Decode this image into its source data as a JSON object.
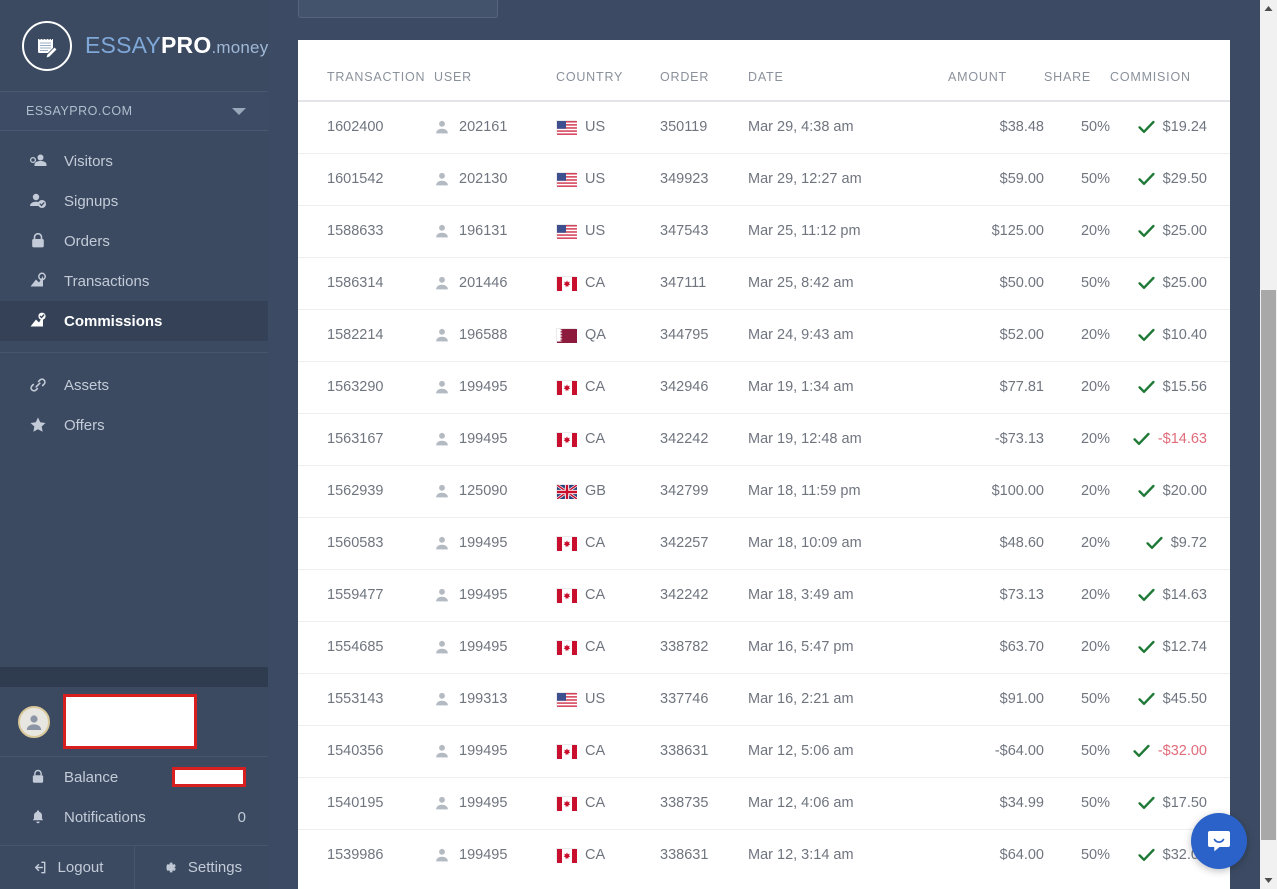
{
  "brand": {
    "logo_essay": "ESSAY",
    "logo_pro": "PRO",
    "logo_money": ".money",
    "accent_color": "#7fa8d8",
    "sidebar_color": "#3b4a61"
  },
  "sidebar": {
    "site_selector": {
      "label": "ESSAYPRO.COM",
      "icon": "chevron-down-icon"
    },
    "nav_primary": [
      {
        "label": "Visitors",
        "icon": "visitors-icon",
        "active": false
      },
      {
        "label": "Signups",
        "icon": "signups-icon",
        "active": false
      },
      {
        "label": "Orders",
        "icon": "orders-icon",
        "active": false
      },
      {
        "label": "Transactions",
        "icon": "transactions-icon",
        "active": false
      },
      {
        "label": "Commissions",
        "icon": "commissions-icon",
        "active": true
      }
    ],
    "nav_secondary": [
      {
        "label": "Assets",
        "icon": "link-icon",
        "active": false
      },
      {
        "label": "Offers",
        "icon": "star-icon",
        "active": false
      }
    ],
    "profile": {
      "username": "",
      "username_redacted": true,
      "avatar_icon": "avatar-icon"
    },
    "meta": [
      {
        "label": "Balance",
        "icon": "lock-icon",
        "value": "",
        "redacted": true
      },
      {
        "label": "Notifications",
        "icon": "bell-icon",
        "value": "0",
        "redacted": false
      }
    ],
    "bottom": [
      {
        "label": "Logout",
        "icon": "logout-icon"
      },
      {
        "label": "Settings",
        "icon": "gear-icon"
      }
    ]
  },
  "table": {
    "headers": {
      "transaction": "TRANSACTION",
      "user": "USER",
      "country": "COUNTRY",
      "order": "ORDER",
      "date": "DATE",
      "amount": "AMOUNT",
      "share": "SHARE",
      "commision": "COMMISION"
    },
    "rows": [
      {
        "transaction": "1602400",
        "user": "202161",
        "country": "US",
        "order": "350119",
        "date": "Mar 29, 4:38 am",
        "amount": "$38.48",
        "share": "50%",
        "commision": "$19.24",
        "amount_negative": false,
        "commision_negative": false,
        "approved": true
      },
      {
        "transaction": "1601542",
        "user": "202130",
        "country": "US",
        "order": "349923",
        "date": "Mar 29, 12:27 am",
        "amount": "$59.00",
        "share": "50%",
        "commision": "$29.50",
        "amount_negative": false,
        "commision_negative": false,
        "approved": true
      },
      {
        "transaction": "1588633",
        "user": "196131",
        "country": "US",
        "order": "347543",
        "date": "Mar 25, 11:12 pm",
        "amount": "$125.00",
        "share": "20%",
        "commision": "$25.00",
        "amount_negative": false,
        "commision_negative": false,
        "approved": true
      },
      {
        "transaction": "1586314",
        "user": "201446",
        "country": "CA",
        "order": "347111",
        "date": "Mar 25, 8:42 am",
        "amount": "$50.00",
        "share": "50%",
        "commision": "$25.00",
        "amount_negative": false,
        "commision_negative": false,
        "approved": true
      },
      {
        "transaction": "1582214",
        "user": "196588",
        "country": "QA",
        "order": "344795",
        "date": "Mar 24, 9:43 am",
        "amount": "$52.00",
        "share": "20%",
        "commision": "$10.40",
        "amount_negative": false,
        "commision_negative": false,
        "approved": true
      },
      {
        "transaction": "1563290",
        "user": "199495",
        "country": "CA",
        "order": "342946",
        "date": "Mar 19, 1:34 am",
        "amount": "$77.81",
        "share": "20%",
        "commision": "$15.56",
        "amount_negative": false,
        "commision_negative": false,
        "approved": true
      },
      {
        "transaction": "1563167",
        "user": "199495",
        "country": "CA",
        "order": "342242",
        "date": "Mar 19, 12:48 am",
        "amount": "-$73.13",
        "share": "20%",
        "commision": "-$14.63",
        "amount_negative": true,
        "commision_negative": true,
        "approved": true
      },
      {
        "transaction": "1562939",
        "user": "125090",
        "country": "GB",
        "order": "342799",
        "date": "Mar 18, 11:59 pm",
        "amount": "$100.00",
        "share": "20%",
        "commision": "$20.00",
        "amount_negative": false,
        "commision_negative": false,
        "approved": true
      },
      {
        "transaction": "1560583",
        "user": "199495",
        "country": "CA",
        "order": "342257",
        "date": "Mar 18, 10:09 am",
        "amount": "$48.60",
        "share": "20%",
        "commision": "$9.72",
        "amount_negative": false,
        "commision_negative": false,
        "approved": true
      },
      {
        "transaction": "1559477",
        "user": "199495",
        "country": "CA",
        "order": "342242",
        "date": "Mar 18, 3:49 am",
        "amount": "$73.13",
        "share": "20%",
        "commision": "$14.63",
        "amount_negative": false,
        "commision_negative": false,
        "approved": true
      },
      {
        "transaction": "1554685",
        "user": "199495",
        "country": "CA",
        "order": "338782",
        "date": "Mar 16, 5:47 pm",
        "amount": "$63.70",
        "share": "20%",
        "commision": "$12.74",
        "amount_negative": false,
        "commision_negative": false,
        "approved": true
      },
      {
        "transaction": "1553143",
        "user": "199313",
        "country": "US",
        "order": "337746",
        "date": "Mar 16, 2:21 am",
        "amount": "$91.00",
        "share": "50%",
        "commision": "$45.50",
        "amount_negative": false,
        "commision_negative": false,
        "approved": true
      },
      {
        "transaction": "1540356",
        "user": "199495",
        "country": "CA",
        "order": "338631",
        "date": "Mar 12, 5:06 am",
        "amount": "-$64.00",
        "share": "50%",
        "commision": "-$32.00",
        "amount_negative": true,
        "commision_negative": true,
        "approved": true
      },
      {
        "transaction": "1540195",
        "user": "199495",
        "country": "CA",
        "order": "338735",
        "date": "Mar 12, 4:06 am",
        "amount": "$34.99",
        "share": "50%",
        "commision": "$17.50",
        "amount_negative": false,
        "commision_negative": false,
        "approved": true
      },
      {
        "transaction": "1539986",
        "user": "199495",
        "country": "CA",
        "order": "338631",
        "date": "Mar 12, 3:14 am",
        "amount": "$64.00",
        "share": "50%",
        "commision": "$32.00",
        "amount_negative": false,
        "commision_negative": false,
        "approved": true
      }
    ]
  },
  "widgets": {
    "chat_launcher": {
      "icon": "intercom-chat-icon",
      "color": "#2a62c9"
    },
    "scrollbar": {
      "up_icon": "scroll-up-arrow-icon",
      "down_icon": "scroll-down-arrow-icon"
    }
  }
}
